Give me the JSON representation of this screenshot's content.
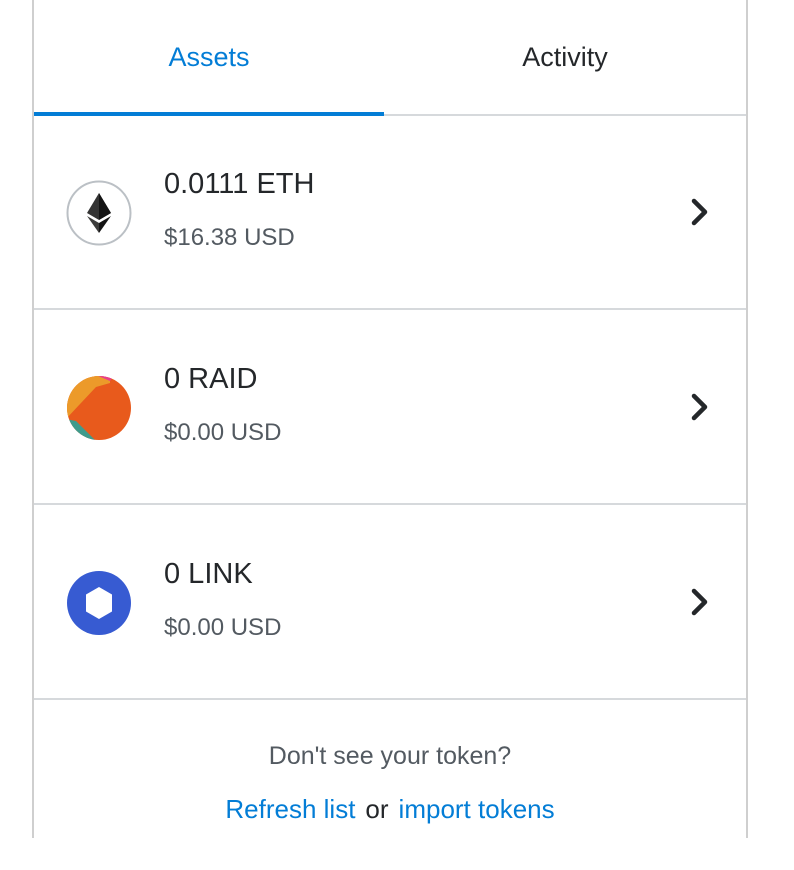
{
  "tabs": {
    "assets_label": "Assets",
    "activity_label": "Activity",
    "active": "Assets"
  },
  "assets": [
    {
      "icon": "ethereum-icon",
      "amount": "0.0111 ETH",
      "fiat": "$16.38 USD"
    },
    {
      "icon": "raid-token-icon",
      "amount": "0 RAID",
      "fiat": "$0.00 USD"
    },
    {
      "icon": "chainlink-icon",
      "amount": "0 LINK",
      "fiat": "$0.00 USD"
    }
  ],
  "footer": {
    "question": "Don't see your token?",
    "refresh_label": "Refresh list",
    "or_label": "or",
    "import_label": "import tokens"
  },
  "colors": {
    "accent": "#037dd6",
    "text": "#24272a",
    "muted": "#535a61",
    "divider": "#d6d9dc",
    "link_icon": "#375bd2"
  }
}
